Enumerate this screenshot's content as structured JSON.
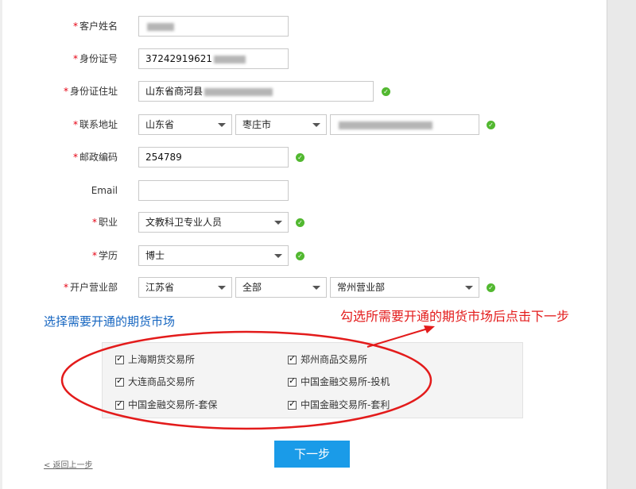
{
  "form": {
    "customer_name": {
      "label": "客户姓名",
      "required": true,
      "value": ""
    },
    "id_number": {
      "label": "身份证号",
      "required": true,
      "value": "37242919621"
    },
    "id_address": {
      "label": "身份证住址",
      "required": true,
      "value": "山东省商河县"
    },
    "contact_address": {
      "label": "联系地址",
      "required": true,
      "province": "山东省",
      "city": "枣庄市",
      "detail": ""
    },
    "postal_code": {
      "label": "邮政编码",
      "required": true,
      "value": "254789"
    },
    "email": {
      "label": "Email",
      "required": false,
      "value": ""
    },
    "occupation": {
      "label": "职业",
      "required": true,
      "value": "文教科卫专业人员"
    },
    "education": {
      "label": "学历",
      "required": true,
      "value": "博士"
    },
    "branch": {
      "label": "开户营业部",
      "required": true,
      "province": "江苏省",
      "area": "全部",
      "office": "常州营业部"
    }
  },
  "required_mark": "*",
  "icons": {
    "valid": "check-circle-icon",
    "dropdown": "chevron-down-icon",
    "checkbox": "checkbox-checked-icon"
  },
  "markets_section": {
    "title": "选择需要开通的期货市场",
    "annotation": "勾选所需要开通的期货市场后点击下一步",
    "markets": [
      {
        "label": "上海期货交易所",
        "checked": true
      },
      {
        "label": "郑州商品交易所",
        "checked": true
      },
      {
        "label": "大连商品交易所",
        "checked": true
      },
      {
        "label": "中国金融交易所-投机",
        "checked": true
      },
      {
        "label": "中国金融交易所-套保",
        "checked": true
      },
      {
        "label": "中国金融交易所-套利",
        "checked": true
      }
    ]
  },
  "actions": {
    "next": "下一步",
    "back": "< 返回上一步"
  },
  "colors": {
    "required": "#e60012",
    "valid": "#52b830",
    "section_title": "#1565c0",
    "annotation": "#e31b1b",
    "primary_button": "#1a9be8"
  }
}
